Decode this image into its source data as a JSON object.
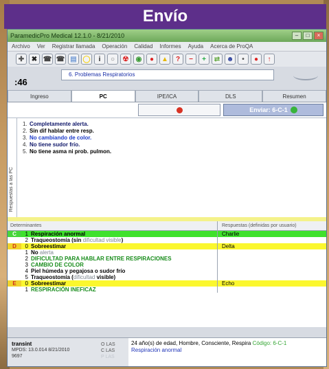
{
  "banner": {
    "title": "Envío"
  },
  "window": {
    "title": "ParamedicPro Medical 12.1.0 - 8/21/2010",
    "menu": [
      "Archivo",
      "Ver",
      "Registrar llamada",
      "Operación",
      "Calidad",
      "Informes",
      "Ayuda",
      "Acerca de ProQA"
    ],
    "buttons": {
      "minimize": "–",
      "maximize": "□",
      "close": "×"
    }
  },
  "toolbar_icons": [
    "move-icon",
    "cancel-icon",
    "phone-icon",
    "phone-icon",
    "document-icon",
    "note-icon",
    "info-icon",
    "circle-icon",
    "hazard-icon",
    "globe-icon",
    "stop-icon",
    "warning-icon",
    "help-icon",
    "minus-icon",
    "plus-icon",
    "shuffle-icon",
    "face-icon",
    "aed-icon",
    "heart-icon",
    "up-arrow-icon"
  ],
  "toolbar_glyphs": [
    "✚",
    "✖",
    "☎",
    "☎",
    "▤",
    "◯",
    "i",
    "○",
    "☢",
    "◉",
    "●",
    "▲",
    "?",
    "−",
    "+",
    "⇄",
    "☻",
    "•",
    "●",
    "↑"
  ],
  "toolbar_colors": [
    "#555",
    "#222",
    "#444",
    "#444",
    "#7aa0d8",
    "#f4d21b",
    "#222",
    "#777",
    "#d22",
    "#3a9a35",
    "#d22",
    "#e6b80a",
    "#d22",
    "#d22",
    "#2a4",
    "#6a4",
    "#2b3f9d",
    "#555",
    "#d22",
    "#d22"
  ],
  "case": {
    "code": ":46",
    "protocol": "6.  Problemas Respiratorios"
  },
  "tabs": [
    "Ingreso",
    "PC",
    "IPE/ICA",
    "DLS",
    "Resumen"
  ],
  "active_tab": "PC",
  "actions": {
    "send_label": "Enviar: 6-C-1"
  },
  "responses": {
    "side_label": "Respuestas a las PC",
    "items": [
      {
        "num": "1.",
        "text": "Completamente alerta.",
        "color": "#10186a"
      },
      {
        "num": "2.",
        "text": "Sin dif hablar entre resp.",
        "color": "#000000"
      },
      {
        "num": "3.",
        "text": "No cambiando de color.",
        "color": "#1d3bc9"
      },
      {
        "num": "4.",
        "text": "No tiene sudor frío.",
        "color": "#10186a"
      },
      {
        "num": "5.",
        "text": "No tiene asma ni prob. pulmon.",
        "color": "#000000"
      }
    ]
  },
  "determinants": {
    "header_left": "Determinantes",
    "header_right": "Respuestas (definidas por usuario)",
    "rows": [
      {
        "level": "C",
        "num": "1",
        "text": "Respiración anormal",
        "response": "Charlie",
        "style": "green"
      },
      {
        "level": "",
        "num": "2",
        "text": "Traqueostomía (sin ",
        "extra": "dificultad visible",
        "extra_after": ")",
        "response": "",
        "style": "plain"
      },
      {
        "level": "D",
        "num": "0",
        "text": "Sobreestimar",
        "response": "Delta",
        "style": "yellow"
      },
      {
        "level": "",
        "num": "1",
        "text": "No ",
        "extra": "alerta",
        "response": "",
        "style": "plain"
      },
      {
        "level": "",
        "num": "2",
        "text": "DIFICULTAD PARA HABLAR ENTRE RESPIRACIONES",
        "response": "",
        "style": "greentext"
      },
      {
        "level": "",
        "num": "3",
        "text": "CAMBIO DE COLOR",
        "response": "",
        "style": "greentext"
      },
      {
        "level": "",
        "num": "4",
        "text": "Piel húmeda y pegajosa o sudor frío",
        "response": "",
        "style": "bold"
      },
      {
        "level": "",
        "num": "5",
        "text": "Traqueostomía (",
        "extra": "dificultad",
        "extra_after": " visible)",
        "response": "",
        "style": "bold"
      },
      {
        "level": "E",
        "num": "0",
        "text": "Sobreestimar",
        "response": "Echo",
        "style": "yellow"
      },
      {
        "level": "",
        "num": "1",
        "text": "RESPIRACIÓN INEFICAZ",
        "response": "",
        "style": "greentext"
      }
    ]
  },
  "footer": {
    "user": "transint",
    "version": "MPDS: 13.0.014  8/21/2010",
    "code": "9697",
    "status": [
      "O LAS",
      "C LAS",
      "P LAS"
    ],
    "summary": "24 año(s) de edad, Hombre, Consciente, Respira",
    "summary_code": "Código: 6-C-1",
    "summary_resp": "Respiración anormal"
  }
}
